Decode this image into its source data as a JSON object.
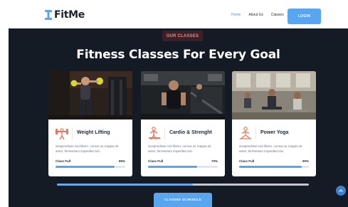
{
  "brand": {
    "name": "FitMe"
  },
  "nav": {
    "links": [
      "Home",
      "About Us",
      "Classes"
    ],
    "active": "Home",
    "login_label": "LOGIN"
  },
  "section": {
    "badge": "OUR CLASSES",
    "title": "Fitness Classes For Every Goal"
  },
  "cards": [
    {
      "title": "Weight Lifting",
      "icon": "weightlifter-icon",
      "description": "Suspendisse nisi libero, cursus ac magna sit amet, fermentum imperdiet nisi.",
      "status": "Class Full",
      "percent_label": "85%",
      "fill_fraction": 0.85
    },
    {
      "title": "Cardio & Strenght",
      "icon": "cardio-icon",
      "description": "Suspendisse nisi libero, cursus ac magna sit amet, fermentum imperdiet nisi.",
      "status": "Class Full",
      "percent_label": "70%",
      "fill_fraction": 0.7
    },
    {
      "title": "Power Yoga",
      "icon": "yoga-icon",
      "description": "Suspendisse nisi libero, cursus ac magna sit amet, fermentum imperdiet nisi.",
      "status": "Class Full",
      "percent_label": "90%",
      "fill_fraction": 0.9
    }
  ],
  "slider": {
    "progress_fraction": 0.54
  },
  "cta": {
    "label": "CLASSES SCHEDULE"
  },
  "colors": {
    "accent": "#5aa5f0",
    "dark_bg": "#141b25",
    "badge_bg": "#3a2028",
    "badge_text": "#ef8a76",
    "icon_orange": "#e8775a"
  }
}
